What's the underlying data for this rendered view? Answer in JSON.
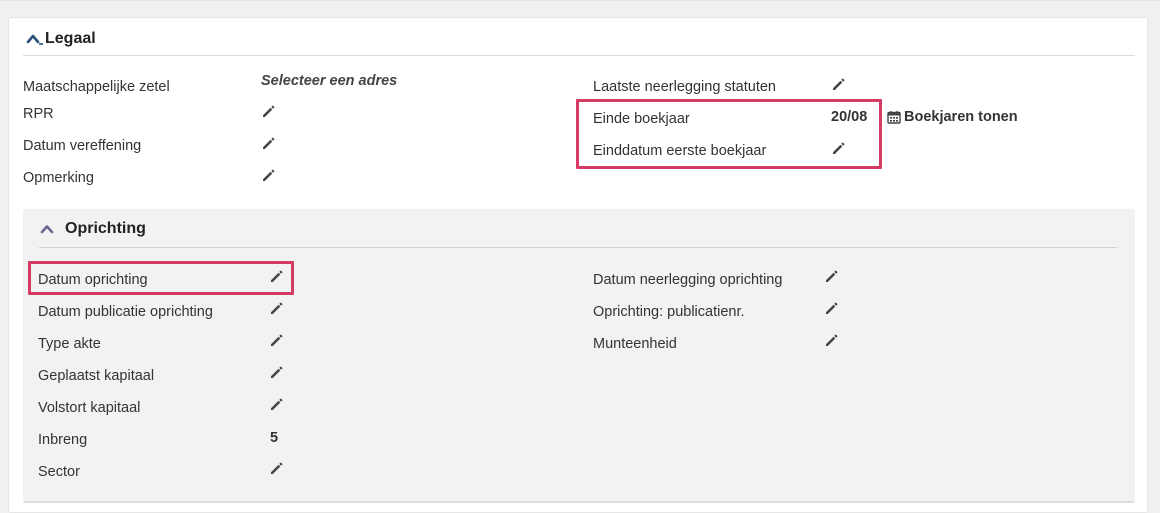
{
  "legaal": {
    "title": "Legaal",
    "left": [
      {
        "label": "Maatschappelijke zetel",
        "value": "Selecteer een adres"
      },
      {
        "label": "RPR"
      },
      {
        "label": "Datum vereffening"
      },
      {
        "label": "Opmerking"
      }
    ],
    "right": [
      {
        "label": "Laatste neerlegging statuten"
      },
      {
        "label": "Einde boekjaar",
        "value": "20/08",
        "link": "Boekjaren tonen"
      },
      {
        "label": "Einddatum eerste boekjaar"
      }
    ]
  },
  "oprichting": {
    "title": "Oprichting",
    "left": [
      {
        "label": "Datum oprichting"
      },
      {
        "label": "Datum publicatie oprichting"
      },
      {
        "label": "Type akte"
      },
      {
        "label": "Geplaatst kapitaal"
      },
      {
        "label": "Volstort kapitaal"
      },
      {
        "label": "Inbreng",
        "value": "5"
      },
      {
        "label": "Sector"
      }
    ],
    "right": [
      {
        "label": "Datum neerlegging oprichting"
      },
      {
        "label": "Oprichting: publicatienr."
      },
      {
        "label": "Munteenheid"
      }
    ]
  },
  "colors": {
    "highlight": "#d63b64",
    "chevron_legaal": "#2a4f7a",
    "chevron_oprichting": "#6b6590"
  },
  "icons": {
    "collapse": "chevron-up-icon",
    "edit": "pencil-icon",
    "calendar": "calendar-icon"
  }
}
